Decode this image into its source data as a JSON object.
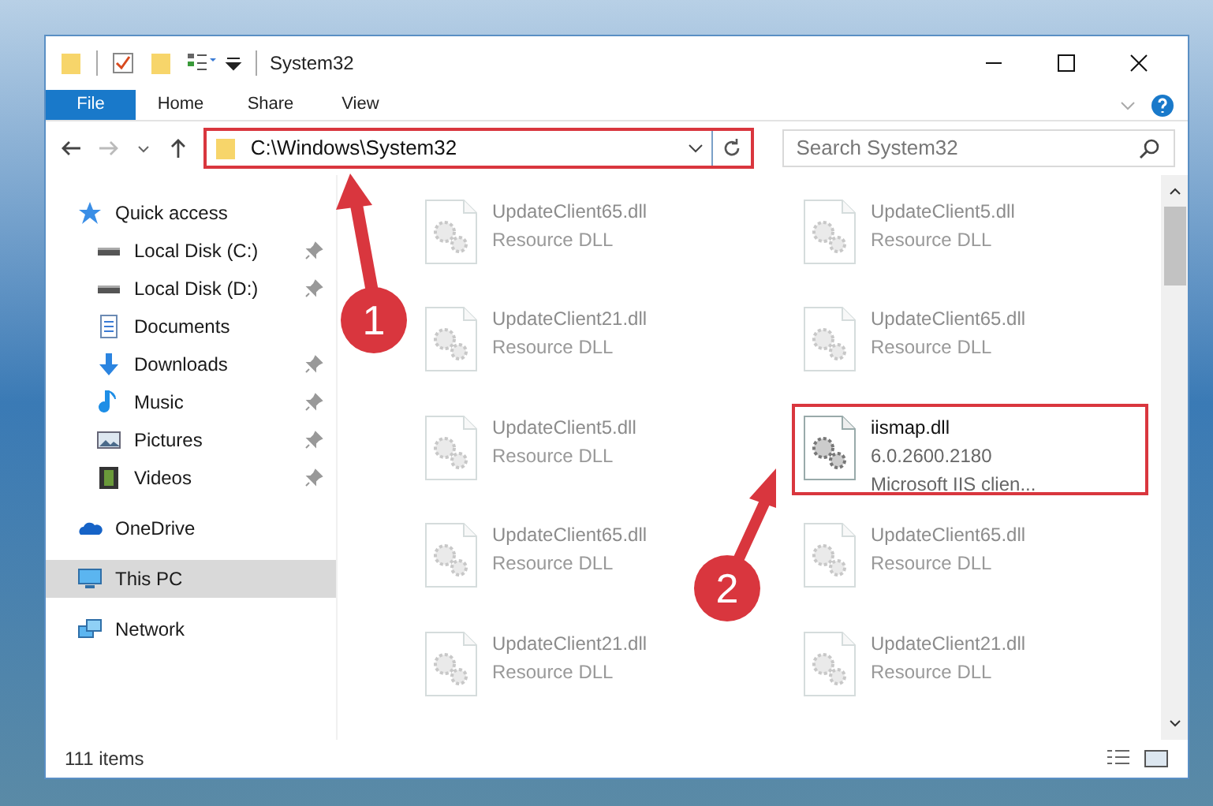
{
  "window": {
    "title": "System32"
  },
  "ribbon_tabs": [
    {
      "label": "File",
      "selected": true
    },
    {
      "label": "Home",
      "selected": false
    },
    {
      "label": "Share",
      "selected": false
    },
    {
      "label": "View",
      "selected": false
    }
  ],
  "address": {
    "path": "C:\\Windows\\System32",
    "highlighted": true
  },
  "search": {
    "placeholder": "Search System32"
  },
  "sidebar": {
    "items": [
      {
        "label": "Quick access",
        "kind": "star",
        "selected": false,
        "children": [
          {
            "label": "Local Disk (C:)",
            "kind": "drive",
            "pinned": true,
            "selected": false
          },
          {
            "label": "Local Disk (D:)",
            "kind": "drive",
            "pinned": true,
            "selected": false
          },
          {
            "label": "Documents",
            "kind": "doc",
            "pinned": false,
            "selected": false
          },
          {
            "label": "Downloads",
            "kind": "download",
            "pinned": true,
            "selected": false
          },
          {
            "label": "Music",
            "kind": "music",
            "pinned": true,
            "selected": false
          },
          {
            "label": "Pictures",
            "kind": "picture",
            "pinned": true,
            "selected": false
          },
          {
            "label": "Videos",
            "kind": "video",
            "pinned": true,
            "selected": false
          }
        ]
      },
      {
        "label": "OneDrive",
        "kind": "cloud",
        "selected": false
      },
      {
        "label": "This PC",
        "kind": "pc",
        "selected": true
      },
      {
        "label": "Network",
        "kind": "network",
        "selected": false
      }
    ]
  },
  "files": [
    {
      "name": "UpdateClient65.dll",
      "details": [
        "Resource DLL"
      ],
      "highlighted": false
    },
    {
      "name": "UpdateClient5.dll",
      "details": [
        "Resource DLL"
      ],
      "highlighted": false
    },
    {
      "name": "UpdateClient21.dll",
      "details": [
        "Resource DLL"
      ],
      "highlighted": false
    },
    {
      "name": "UpdateClient65.dll",
      "details": [
        "Resource DLL"
      ],
      "highlighted": false
    },
    {
      "name": "UpdateClient5.dll",
      "details": [
        "Resource DLL"
      ],
      "highlighted": false
    },
    {
      "name": "iismap.dll",
      "details": [
        "6.0.2600.2180",
        "Microsoft IIS clien..."
      ],
      "highlighted": true
    },
    {
      "name": "UpdateClient65.dll",
      "details": [
        "Resource DLL"
      ],
      "highlighted": false
    },
    {
      "name": "UpdateClient65.dll",
      "details": [
        "Resource DLL"
      ],
      "highlighted": false
    },
    {
      "name": "UpdateClient21.dll",
      "details": [
        "Resource DLL"
      ],
      "highlighted": false
    },
    {
      "name": "UpdateClient21.dll",
      "details": [
        "Resource DLL"
      ],
      "highlighted": false
    }
  ],
  "status_bar": {
    "item_count": "111 items"
  },
  "annotations": [
    {
      "number": "1"
    },
    {
      "number": "2"
    }
  ]
}
